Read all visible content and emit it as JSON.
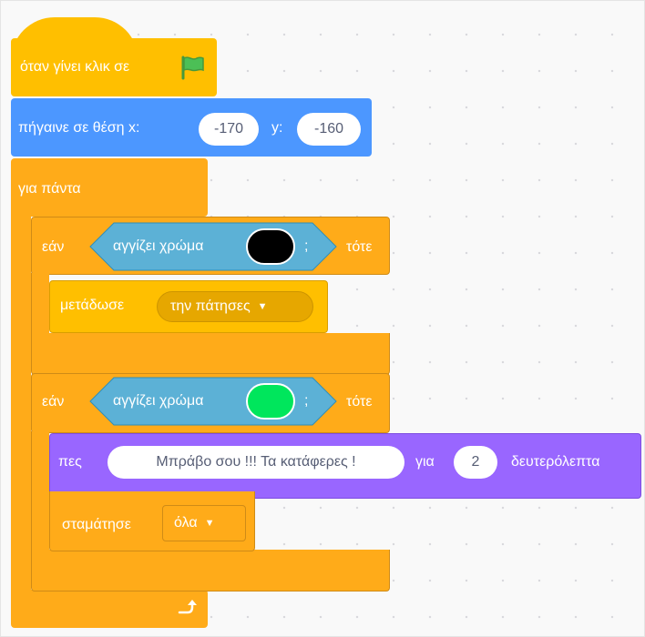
{
  "hat_block": {
    "label": "όταν γίνει κλικ σε",
    "icon": "green-flag-icon"
  },
  "goto_block": {
    "label": "πήγαινε σε θέση x:",
    "x_value": "-170",
    "y_label": "y:",
    "y_value": "-160"
  },
  "forever_block": {
    "label": "για πάντα",
    "loop_icon": "loop-arrow-icon"
  },
  "if_block_1": {
    "if_label": "εάν",
    "sensing_label": "αγγίζει χρώμα",
    "question_mark": ";",
    "then_label": "τότε",
    "color": "#000000",
    "broadcast": {
      "label": "μετάδωσε",
      "message": "την πάτησες"
    }
  },
  "if_block_2": {
    "if_label": "εάν",
    "sensing_label": "αγγίζει χρώμα",
    "question_mark": ";",
    "then_label": "τότε",
    "color": "#00e65c",
    "say": {
      "label": "πες",
      "message": "Μπράβο σου !!! Τα κατάφερες !",
      "for_label": "για",
      "seconds": "2",
      "seconds_label": "δευτερόλεπτα"
    },
    "stop": {
      "label": "σταμάτησε",
      "option": "όλα"
    }
  },
  "colors": {
    "control": "#ffab19",
    "events": "#ffbf00",
    "motion": "#4c97ff",
    "sensing": "#5cb1d6",
    "looks": "#9966ff"
  }
}
